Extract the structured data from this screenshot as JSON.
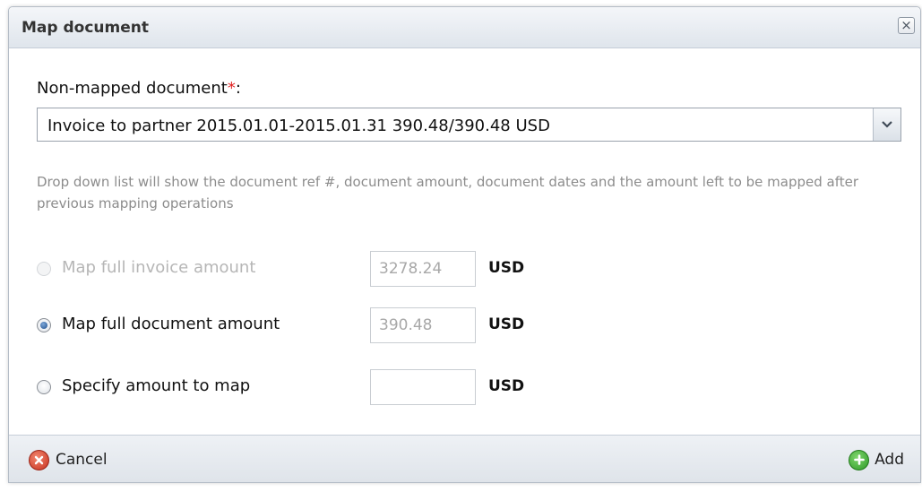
{
  "dialog": {
    "title": "Map document",
    "close_glyph": "×",
    "non_mapped_label": "Non-mapped document",
    "required_mark": "*",
    "label_colon": ":",
    "selected_document": "Invoice to partner 2015.01.01-2015.01.31 390.48/390.48 USD",
    "help_text": "Drop down list will show the document ref #, document amount, document dates and the amount left to be mapped after previous mapping operations",
    "options": [
      {
        "label": "Map full invoice amount",
        "amount": "3278.24",
        "currency": "USD",
        "state": "disabled"
      },
      {
        "label": "Map full document amount",
        "amount": "390.48",
        "currency": "USD",
        "state": "checked"
      },
      {
        "label": "Specify amount to map",
        "amount": "",
        "currency": "USD",
        "state": "unchecked"
      }
    ],
    "footer": {
      "cancel_label": "Cancel",
      "add_label": "Add"
    }
  },
  "icons": {
    "close": "close-icon",
    "dropdown": "chevron-down-icon",
    "cancel": "cancel-circle-icon",
    "add": "plus-circle-icon"
  },
  "colors": {
    "required": "#e02020",
    "help_text": "#8c8c8c",
    "cancel_icon": "#d2402c",
    "add_icon": "#3aa832"
  }
}
